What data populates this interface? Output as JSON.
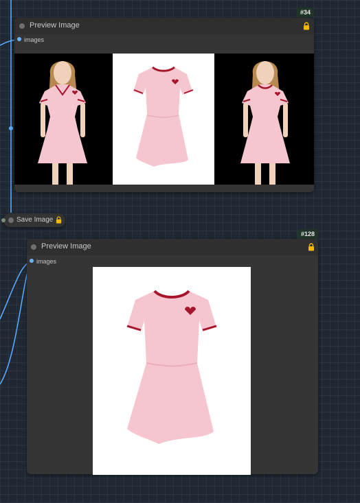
{
  "nodes": {
    "preview_34": {
      "title": "Preview Image",
      "badge": "#34",
      "input_label": "images",
      "colors": {
        "background": "#353535",
        "header": "#2f2f2f"
      }
    },
    "save_image": {
      "title": "Save Image"
    },
    "preview_128": {
      "title": "Preview Image",
      "badge": "#128",
      "input_label": "images"
    }
  },
  "colors": {
    "canvas": "#1f2833",
    "link": "#5aa9ff",
    "lock": "#f2b705",
    "dress": "#f6c6d0",
    "trim": "#a7152b"
  }
}
